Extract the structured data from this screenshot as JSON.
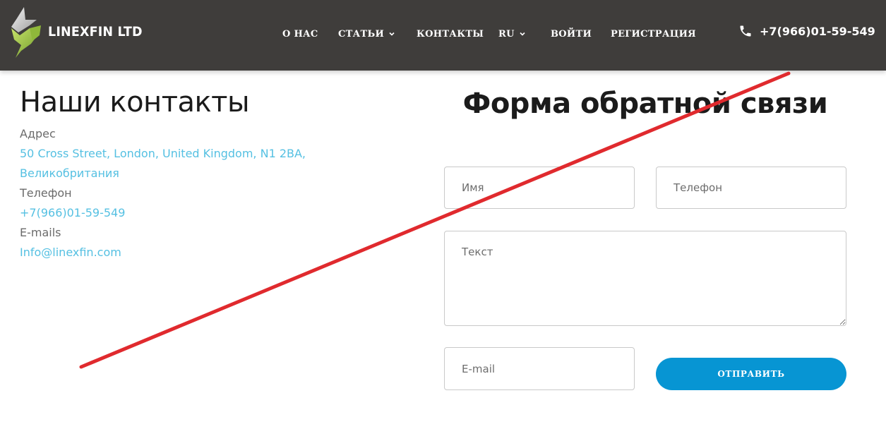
{
  "header": {
    "brand": "LINEXFIN LTD",
    "nav": [
      {
        "label": "О НАС",
        "has_dropdown": false
      },
      {
        "label": "СТАТЬИ",
        "has_dropdown": true
      },
      {
        "label": "КОНТАКТЫ",
        "has_dropdown": false
      },
      {
        "label": "RU",
        "has_dropdown": true
      },
      {
        "label": "ВОЙТИ",
        "has_dropdown": false
      },
      {
        "label": "РЕГИСТРАЦИЯ",
        "has_dropdown": false
      }
    ],
    "phone": "+7(966)01-59-549",
    "phone_icon": "phone-icon",
    "logo_icon": "linexfin-logo-icon"
  },
  "contacts": {
    "title": "Наши контакты",
    "address_label": "Адрес",
    "address_line1": "50 Cross Street, London, United Kingdom, N1 2BA,",
    "address_line2": "Великобритания",
    "phone_label": "Телефон",
    "phone_value": "+7(966)01-59-549",
    "email_label": "E-mails",
    "email_value": "Info@linexfin.com"
  },
  "form": {
    "title": "Форма обратной связи",
    "name_placeholder": "Имя",
    "phone_placeholder": "Телефон",
    "text_placeholder": "Текст",
    "email_placeholder": "E-mail",
    "submit_label": "ОТПРАВИТЬ"
  },
  "colors": {
    "header_bg": "#3f3d3b",
    "link": "#55c0e2",
    "button": "#0795d3",
    "strike_line": "#e02a2e"
  }
}
